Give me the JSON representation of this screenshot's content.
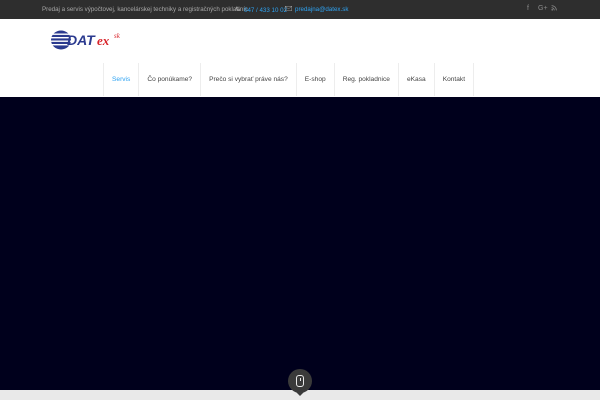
{
  "topbar": {
    "intro": "Predaj a servis výpočtovej, kancelárskej techniky a registračných pokladníc",
    "phone_icon": "phone-icon",
    "phone": "047 / 433 10 02",
    "mail_icon": "mail-icon",
    "email": "predajna@datex.sk",
    "social": [
      {
        "name": "facebook-icon",
        "glyph": "f"
      },
      {
        "name": "google-plus-icon",
        "glyph": "G+"
      },
      {
        "name": "rss-icon",
        "glyph": "rss"
      }
    ]
  },
  "header": {
    "logo": {
      "word": "DATex",
      "suffix": "sk"
    },
    "nav": [
      {
        "label": "Servis",
        "active": true
      },
      {
        "label": "Čo ponúkame?",
        "active": false
      },
      {
        "label": "Prečo si vybrať práve nás?",
        "active": false
      },
      {
        "label": "E-shop",
        "active": false
      },
      {
        "label": "Reg. pokladnice",
        "active": false
      },
      {
        "label": "eKasa",
        "active": false
      },
      {
        "label": "Kontakt",
        "active": false
      }
    ]
  },
  "hero": {
    "background": "#00001c",
    "scroll_icon": "mouse-scroll-icon"
  },
  "colors": {
    "accent": "#2ea3f2",
    "topbar_bg": "#2e2e2e",
    "logo_red": "#d8232a",
    "logo_blue": "#2b3a8f"
  }
}
